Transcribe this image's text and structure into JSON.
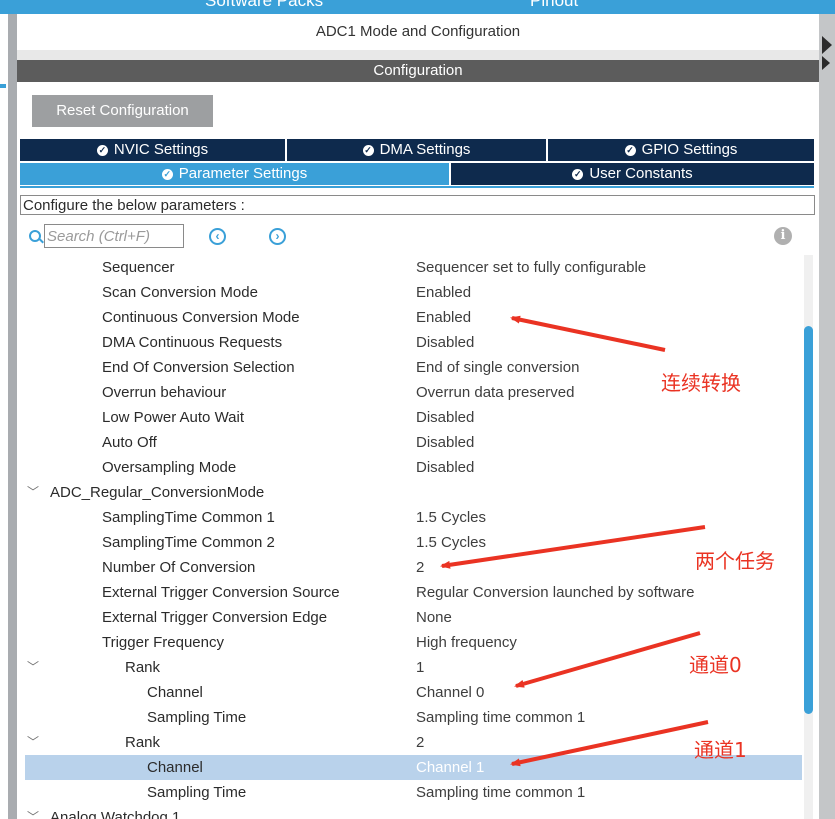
{
  "top_bar": {
    "left_label": "Software Packs",
    "right_label": "Pinout"
  },
  "panel": {
    "title": "ADC1 Mode and Configuration",
    "configuration_label": "Configuration"
  },
  "reset_button": {
    "label": "Reset Configuration"
  },
  "tabs": {
    "row1": [
      {
        "label": "NVIC Settings"
      },
      {
        "label": "DMA Settings"
      },
      {
        "label": "GPIO Settings"
      }
    ],
    "row2": [
      {
        "label": "Parameter Settings",
        "active": true
      },
      {
        "label": "User Constants"
      }
    ]
  },
  "description": "Configure the below parameters :",
  "search": {
    "placeholder": "Search (Ctrl+F)",
    "prev_icon": "chevron-left-circle",
    "next_icon": "chevron-right-circle"
  },
  "params": [
    {
      "name": "Sequencer",
      "value": "Sequencer set to fully configurable"
    },
    {
      "name": "Scan Conversion Mode",
      "value": "Enabled"
    },
    {
      "name": "Continuous Conversion Mode",
      "value": "Enabled"
    },
    {
      "name": "DMA Continuous Requests",
      "value": "Disabled"
    },
    {
      "name": "End Of Conversion Selection",
      "value": "End of single conversion"
    },
    {
      "name": "Overrun behaviour",
      "value": "Overrun data preserved"
    },
    {
      "name": "Low Power Auto Wait",
      "value": "Disabled"
    },
    {
      "name": "Auto Off",
      "value": "Disabled"
    },
    {
      "name": "Oversampling Mode",
      "value": "Disabled"
    },
    {
      "name": "ADC_Regular_ConversionMode",
      "value": ""
    },
    {
      "name": "SamplingTime Common 1",
      "value": "1.5 Cycles"
    },
    {
      "name": "SamplingTime Common 2",
      "value": "1.5 Cycles"
    },
    {
      "name": "Number Of Conversion",
      "value": "2"
    },
    {
      "name": "External Trigger Conversion Source",
      "value": "Regular Conversion launched by software"
    },
    {
      "name": "External Trigger Conversion Edge",
      "value": "None"
    },
    {
      "name": "Trigger Frequency",
      "value": "High frequency"
    },
    {
      "name": "Rank",
      "value": "1"
    },
    {
      "name": "Channel",
      "value": "Channel 0"
    },
    {
      "name": "Sampling Time",
      "value": "Sampling time common 1"
    },
    {
      "name": "Rank",
      "value": "2"
    },
    {
      "name": "Channel",
      "value": "Channel 1",
      "selected": true
    },
    {
      "name": "Sampling Time",
      "value": "Sampling time common 1"
    },
    {
      "name": "Analog Watchdog 1",
      "value": ""
    }
  ],
  "annotations": {
    "continuous": "连续转换",
    "two_tasks": "两个任务",
    "channel0": "通道0",
    "channel1": "通道1"
  },
  "colors": {
    "accent": "#3aa0d8",
    "tab_dark": "#0e2a4d",
    "annotation_red": "#ea3323",
    "selected_row": "#b9d2eb"
  }
}
